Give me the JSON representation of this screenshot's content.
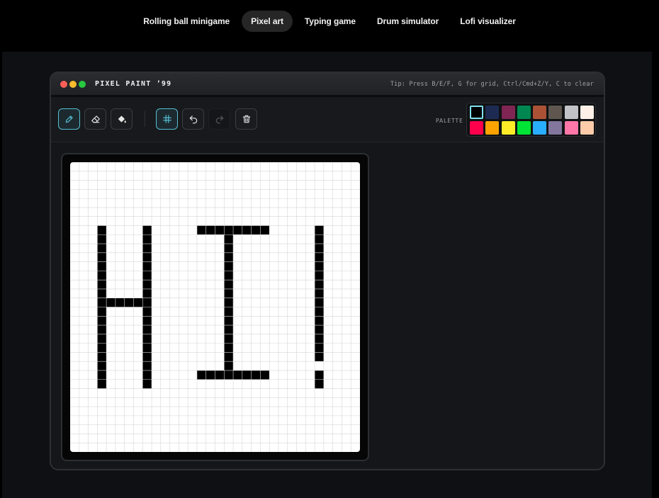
{
  "nav": {
    "items": [
      {
        "label": "Rolling ball minigame",
        "active": false
      },
      {
        "label": "Pixel art",
        "active": true
      },
      {
        "label": "Typing game",
        "active": false
      },
      {
        "label": "Drum simulator",
        "active": false
      },
      {
        "label": "Lofi visualizer",
        "active": false
      }
    ]
  },
  "window": {
    "title": "PIXEL PAINT ’99",
    "tip": "Tip: Press B/E/F, G for grid, Ctrl/Cmd+Z/Y, C to clear",
    "traffic_lights": [
      "#ff5f57",
      "#febc2e",
      "#28c840"
    ]
  },
  "toolbar": {
    "tools": [
      {
        "icon": "pencil-icon",
        "active": true
      },
      {
        "icon": "eraser-icon",
        "active": false
      },
      {
        "icon": "fill-bucket-icon",
        "active": false
      }
    ],
    "actions": [
      {
        "icon": "grid-icon",
        "active": true
      },
      {
        "icon": "undo-icon",
        "active": false
      },
      {
        "icon": "redo-icon",
        "disabled": true
      },
      {
        "icon": "trash-icon",
        "active": false
      }
    ],
    "accent": "#56bfd3"
  },
  "palette": {
    "label": "PALETTE",
    "selected": 0,
    "colors": [
      "#000000",
      "#1d2b53",
      "#7e2553",
      "#008751",
      "#ab5236",
      "#5f574f",
      "#c2c3c7",
      "#fff1e8",
      "#ff004d",
      "#ffa300",
      "#ffec27",
      "#00e436",
      "#29adff",
      "#83769c",
      "#ff77a8",
      "#ffccaa"
    ]
  },
  "canvas": {
    "grid_cells": 32,
    "grid_visible": true,
    "background": "#ffffff",
    "ink": "#000000",
    "filled": [
      [
        3,
        7,
        3,
        24
      ],
      [
        8,
        7,
        8,
        24
      ],
      [
        4,
        15,
        7,
        15
      ],
      [
        14,
        7,
        21,
        7
      ],
      [
        14,
        23,
        21,
        23
      ],
      [
        17,
        8,
        17,
        22
      ],
      [
        27,
        7,
        27,
        21
      ],
      [
        27,
        23,
        27,
        24
      ]
    ]
  }
}
